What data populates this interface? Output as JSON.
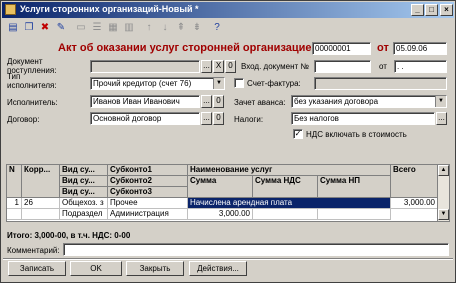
{
  "window": {
    "title": "Услуги сторонних организаций-Новый *",
    "controls": [
      "_",
      "□",
      "×"
    ]
  },
  "toolbar": {
    "icons": [
      "doc-icon",
      "copy-icon",
      "delete-icon",
      "edit-icon",
      "row-icon",
      "rows-icon",
      "grid-icon",
      "grid2-icon",
      "up-arrow-icon",
      "down-arrow-icon",
      "sort-asc-icon",
      "sort-desc-icon",
      "help-icon"
    ]
  },
  "header": {
    "doc_title": "Акт об оказании услуг сторонней организацией №",
    "doc_number": "00000001",
    "from_label": "от",
    "doc_date": "05.09.06"
  },
  "form": {
    "incoming_doc_label": "Документ поступления:",
    "incoming_doc_value": "",
    "incoming_doc_x": "X",
    "incoming_doc_zero": "0",
    "vhod_doc_label": "Вход. документ №",
    "vhod_doc_value": "",
    "vhod_from_label": "от",
    "vhod_date_value": ". .",
    "executor_type_label": "Тип исполнителя:",
    "executor_type_value": "Прочий кредитор (счет 76)",
    "invoice_label": "Счет-фактура:",
    "invoice_value": "",
    "executor_label": "Исполнитель:",
    "executor_value": "Иванов Иван Иванович",
    "advance_label": "Зачет аванса:",
    "advance_value": "без указания договора",
    "contract_label": "Договор:",
    "contract_value": "Основной договор",
    "taxes_label": "Налоги:",
    "taxes_value": "Без налогов",
    "vat_include_label": "НДС включать в стоимость",
    "vat_include_checked": "✓",
    "more_btn": "...",
    "zero_btn": "0"
  },
  "table": {
    "headers": {
      "n": "N",
      "corr": "Корр...",
      "vid1": "Вид су...",
      "vid2": "Вид су...",
      "vid3": "Вид су...",
      "sub1": "Субконто1",
      "sub2": "Субконто2",
      "sub3": "Субконто3",
      "service_name": "Наименование услуг",
      "sum": "Сумма",
      "sum_vat": "Сумма НДС",
      "sum_np": "Сумма НП",
      "total": "Всего"
    },
    "rows": [
      {
        "n": "1",
        "corr": "26",
        "vid1": "Общехоз. з",
        "vid2": "Подраздел",
        "sub1": "Прочее",
        "sub2": "Администрация",
        "service_name": "Начислена арендная плата",
        "sum": "3,000.00",
        "total": "3,000.00"
      }
    ]
  },
  "footer": {
    "totals_text": "Итого: 3,000-00, в т.ч. НДС: 0-00",
    "comment_label": "Комментарий:",
    "comment_value": "",
    "buttons": {
      "record": "Записать",
      "ok": "OK",
      "close": "Закрыть",
      "actions": "Действия..."
    }
  }
}
